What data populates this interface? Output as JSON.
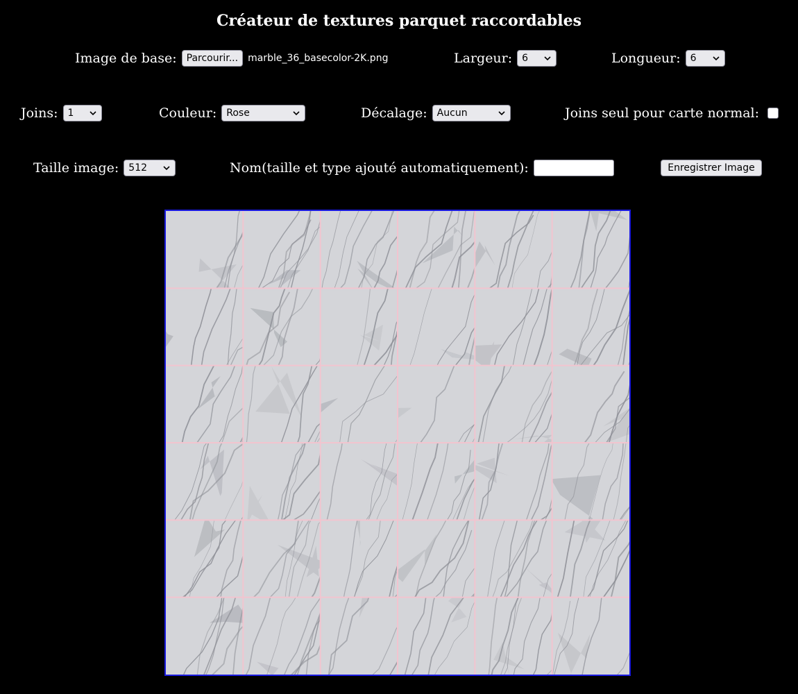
{
  "title": "Créateur de textures parquet raccordables",
  "row1": {
    "image_label": "Image de base:",
    "browse_label": "Parcourir...",
    "file_name": "marble_36_basecolor-2K.png",
    "largeur_label": "Largeur:",
    "largeur_value": "6",
    "longueur_label": "Longueur:",
    "longueur_value": "6"
  },
  "row2": {
    "joins_label": "Joins:",
    "joins_value": "1",
    "couleur_label": "Couleur:",
    "couleur_value": "Rose",
    "decalage_label": "Décalage:",
    "decalage_value": "Aucun",
    "normal_label": "Joins seul pour carte normal:",
    "normal_checked": false
  },
  "row3": {
    "taille_label": "Taille image:",
    "taille_value": "512",
    "nom_label": "Nom(taille et type ajouté automatiquement):",
    "nom_value": "",
    "save_label": "Enregistrer Image"
  },
  "preview": {
    "columns": 6,
    "rows": 6,
    "joint_color": "#f2c4cf",
    "border_color": "#1a1ae0",
    "tile_base_color": "#d4d5d9",
    "vein_color": "#8d8f96"
  }
}
